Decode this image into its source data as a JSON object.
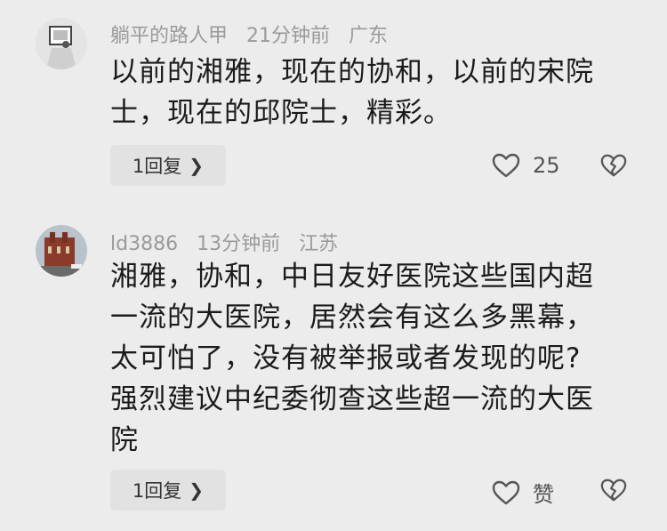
{
  "comments": [
    {
      "username": "躺平的路人甲",
      "time": "21分钟前",
      "location": "广东",
      "text_line1": "以前的湘雅，现在的协和，以前的宋院",
      "text_line2": "士，现在的邱院士，精彩。",
      "reply_label": "1回复",
      "like_count": "25"
    },
    {
      "username": "ld3886",
      "time": "13分钟前",
      "location": "江苏",
      "text_line1": "湘雅，协和，中日友好医院这些国内超",
      "text_line2": "一流的大医院，居然会有这么多黑幕，",
      "text_line3": "太可怕了，没有被举报或者发现的呢?",
      "text_line4": "强烈建议中纪委彻查这些超一流的大医",
      "text_line5": "院",
      "reply_label": "1回复",
      "like_count": "赞"
    }
  ],
  "icons": {
    "like": "heart-outline-icon",
    "dislike": "broken-heart-icon",
    "chevron": "chevron-right-icon"
  }
}
